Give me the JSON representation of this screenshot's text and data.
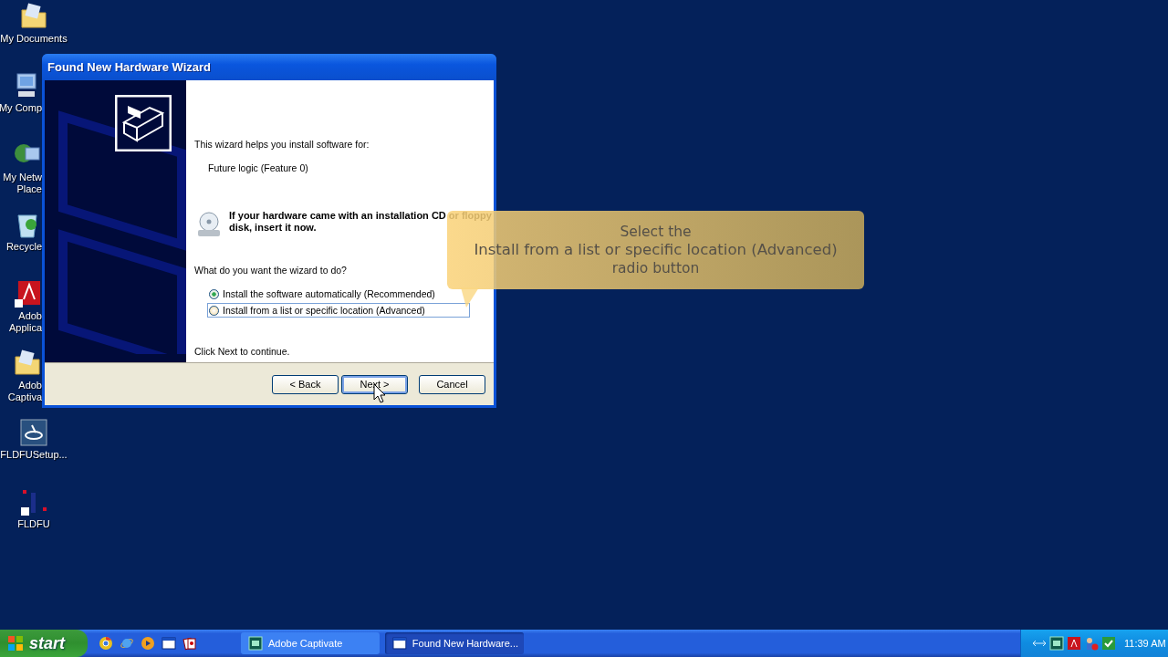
{
  "desktop_icons": [
    {
      "label": "My Documents",
      "kind": "folder",
      "cut": false
    },
    {
      "label": "My Comp",
      "kind": "computer",
      "cut": true
    },
    {
      "label": "My Netw\nPlace",
      "kind": "network",
      "cut": true
    },
    {
      "label": "Recycle",
      "kind": "recycle",
      "cut": true
    },
    {
      "label": "Adob\nApplica",
      "kind": "adobe",
      "cut": true
    },
    {
      "label": "Adob\nCaptiva",
      "kind": "folder",
      "cut": true
    },
    {
      "label": "FLDFUSetup...",
      "kind": "setup",
      "cut": false
    },
    {
      "label": "FLDFU",
      "kind": "fldfu",
      "cut": false
    }
  ],
  "wizard": {
    "title": "Found New Hardware Wizard",
    "intro": "This wizard helps you install software for:",
    "device": "Future logic (Feature 0)",
    "cd_notice": "If your hardware came with an installation CD or floppy disk, insert it now.",
    "question": "What do you want the wizard to do?",
    "options": [
      {
        "label": "Install the software automatically (Recommended)",
        "selected": true,
        "focused": false
      },
      {
        "label": "Install from a list or specific location (Advanced)",
        "selected": false,
        "focused": true
      }
    ],
    "continue_hint": "Click Next to continue.",
    "buttons": [
      {
        "label": "< Back",
        "default": false
      },
      {
        "label": "Next >",
        "default": true
      },
      {
        "label": "Cancel",
        "default": false
      }
    ]
  },
  "callout": {
    "lines": [
      "Select the",
      "Install from a list or specific location (Advanced)",
      "radio button"
    ]
  },
  "taskbar": {
    "start": "start",
    "quick_launch": [
      {
        "kind": "chrome"
      },
      {
        "kind": "ie"
      },
      {
        "kind": "media"
      },
      {
        "kind": "window"
      },
      {
        "kind": "cards"
      }
    ],
    "tasks": [
      {
        "label": "Adobe Captivate",
        "kind": "captivate",
        "selected": false
      },
      {
        "label": "Found New Hardware...",
        "kind": "window",
        "selected": true
      }
    ],
    "tray_icons": [
      {
        "kind": "network"
      },
      {
        "kind": "captivate"
      },
      {
        "kind": "adobe"
      },
      {
        "kind": "users"
      },
      {
        "kind": "check"
      }
    ],
    "time": "11:39 AM"
  }
}
